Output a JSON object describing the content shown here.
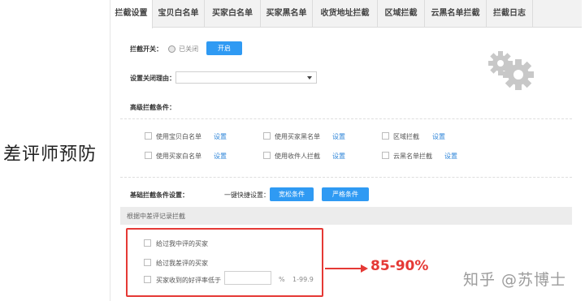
{
  "side_title": "差评师预防",
  "tabs": [
    "拦截设置",
    "宝贝白名单",
    "买家白名单",
    "买家黑名单",
    "收货地址拦截",
    "区域拦截",
    "云黑名单拦截",
    "拦截日志"
  ],
  "switch": {
    "label": "拦截开关：",
    "status": "已关闭",
    "button": "开启"
  },
  "close_reason": {
    "label": "设置关闭理由：",
    "value": ""
  },
  "advanced": {
    "title": "高级拦截条件：",
    "set_label": "设置",
    "options": [
      "使用宝贝白名单",
      "使用买家黑名单",
      "区域拦截",
      "使用买家白名单",
      "使用收件人拦截",
      "云黑名单拦截"
    ]
  },
  "basic": {
    "title": "基础拦截条件设置：",
    "quick_label": "一键快捷设置：",
    "loose_button": "宽松条件",
    "strict_button": "严格条件",
    "section": "根据中差评记录拦截",
    "options": [
      "给过我中评的买家",
      "给过我差评的买家",
      "买家收到的好评率低于"
    ],
    "rate_unit": "%",
    "rate_range": "1-99.9"
  },
  "annotation": "85-90%",
  "watermark": "知乎 @苏博士"
}
